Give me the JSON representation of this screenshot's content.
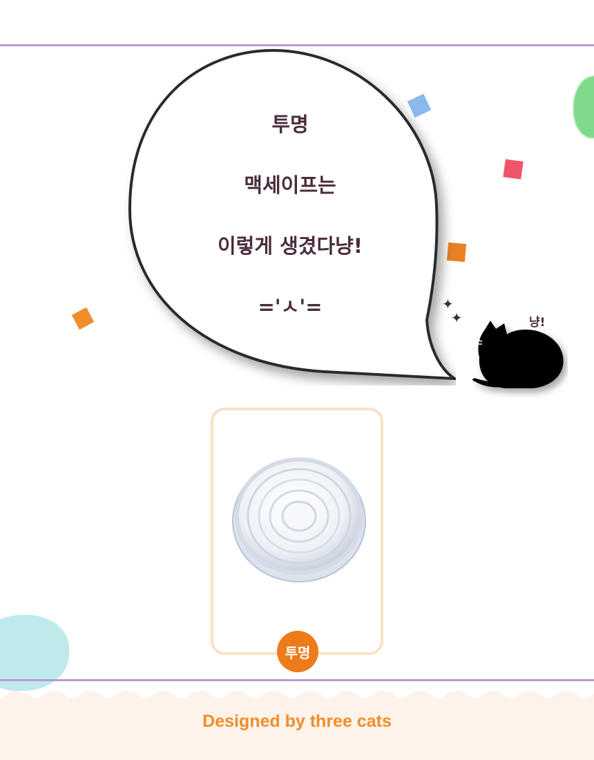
{
  "bubble": {
    "lines": [
      "투명",
      "맥세이프는",
      "이렇게 생겼다냥!",
      "='ㅅ'="
    ]
  },
  "cat": {
    "meow": "냥!"
  },
  "product": {
    "badge": "투명"
  },
  "footer": {
    "text": "Designed by three cats"
  },
  "colors": {
    "rule": "#b89ad4",
    "card_border": "#fbe0c6",
    "badge": "#ee7b1a",
    "footer_text": "#f08d2b",
    "confetti": [
      "#8bb8ee",
      "#f0566a",
      "#e88126",
      "#f08d2b"
    ]
  }
}
